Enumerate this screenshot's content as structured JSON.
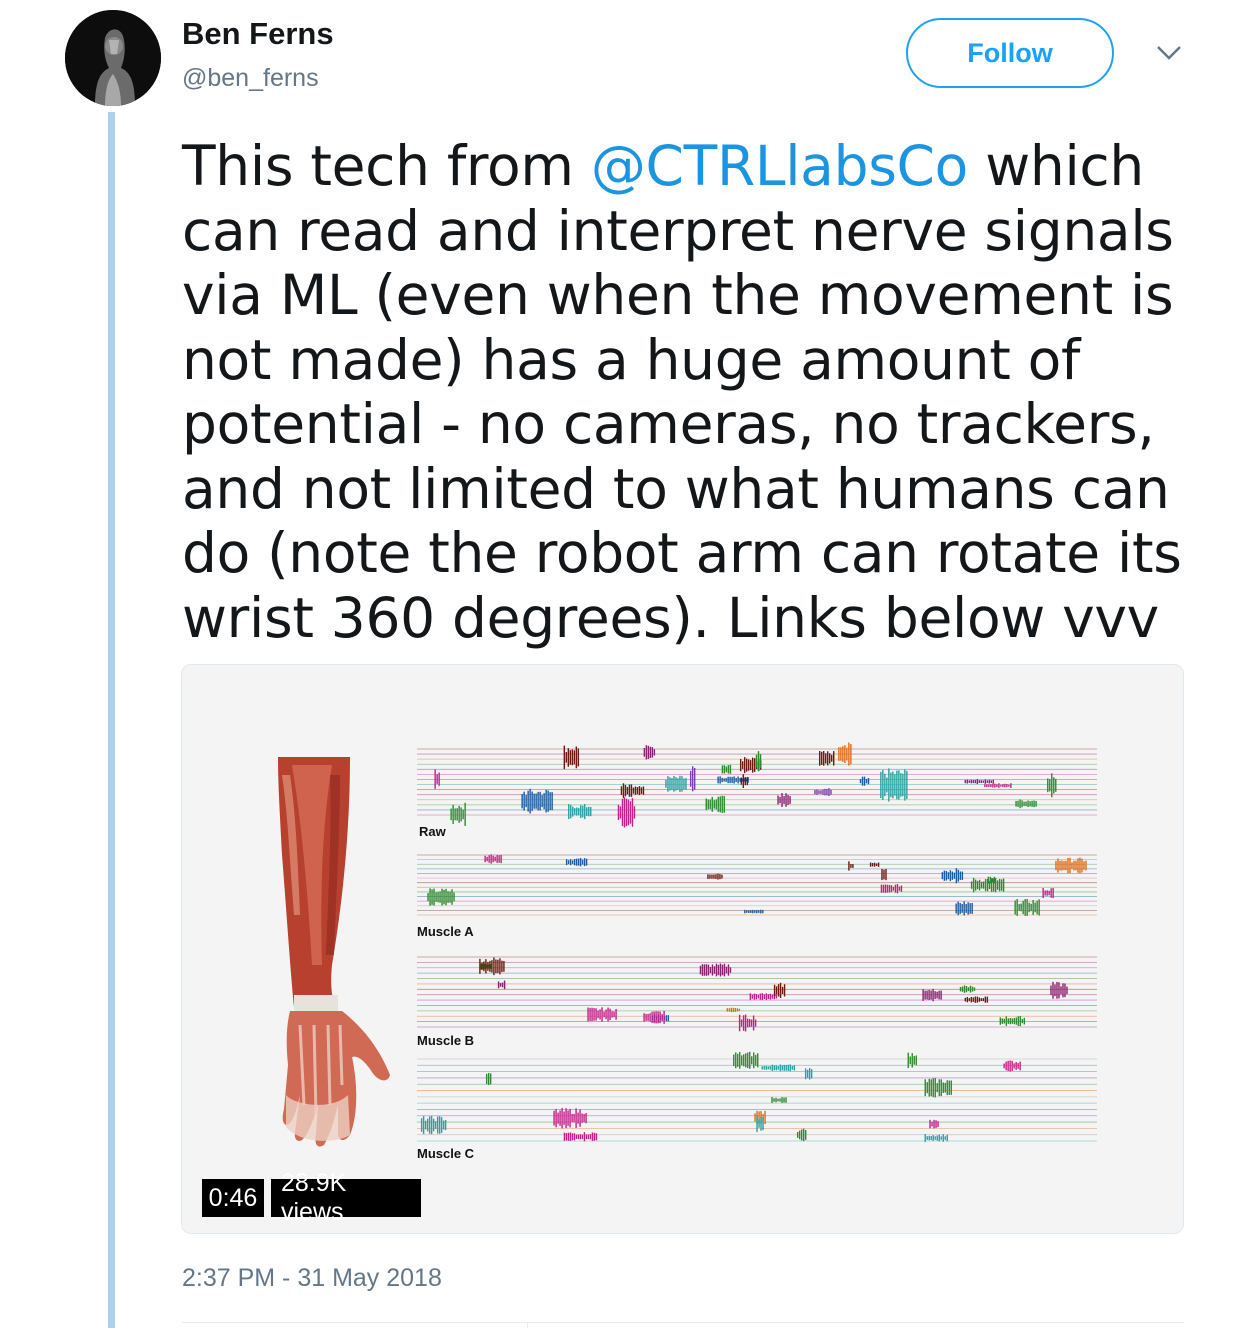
{
  "author": {
    "display_name": "Ben Ferns",
    "handle": "@ben_ferns"
  },
  "follow_button": {
    "label": "Follow"
  },
  "tweet": {
    "text_before": "This tech from ",
    "mention": "@CTRLlabsCo",
    "text_after": " which can read and interpret nerve signals via ML (even when the movement is not made) has a huge amount of potential - no cameras, no trackers, and not limited to what humans can do (note the robot arm can rotate its wrist 360 degrees). Links below vvv",
    "timestamp": "2:37 PM - 31 May 2018"
  },
  "media": {
    "duration": "0:46",
    "views": "28.9K views",
    "labels": [
      "Raw",
      "Muscle A",
      "Muscle B",
      "Muscle C"
    ]
  },
  "icons": {
    "menu": "chevron-down-icon",
    "avatar": "avatar"
  },
  "colors": {
    "accent": "#1da1f2",
    "mention": "#1b95e0",
    "secondary_text": "#657786",
    "thread_line": "#aed0ea"
  }
}
